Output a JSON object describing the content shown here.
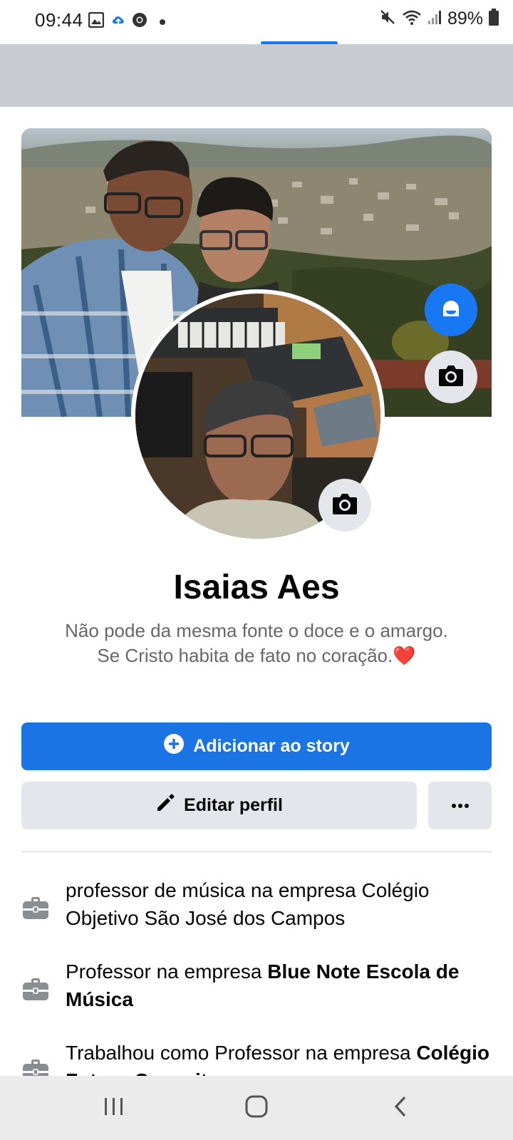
{
  "status_bar": {
    "time": "09:44",
    "battery": "89%",
    "left_icons": [
      "gallery-icon",
      "cloud-upload-icon",
      "chrome-icon",
      "dot-icon"
    ],
    "right_icons": [
      "mute-icon",
      "wifi-icon",
      "signal-icon",
      "battery-icon"
    ]
  },
  "profile": {
    "name": "Isaias Aes",
    "bio_line1": "Não pode da mesma fonte o doce e o amargo.",
    "bio_line2": "Se Cristo habita de fato no coração.",
    "bio_emoji": "❤️"
  },
  "actions": {
    "add_story_label": "Adicionar ao story",
    "edit_profile_label": "Editar perfil",
    "more_label": "•••"
  },
  "info": [
    {
      "prefix": "professor de música na empresa Colégio Objetivo São José dos Campos",
      "bold": ""
    },
    {
      "prefix": "Professor na empresa ",
      "bold": "Blue Note Escola de Música"
    },
    {
      "prefix": "Trabalhou como Professor na empresa ",
      "bold": "Colégio Futuro Conceito"
    }
  ],
  "colors": {
    "accent": "#1b74e4",
    "secondary_button": "#e4e6eb",
    "muted_text": "#65676b"
  }
}
